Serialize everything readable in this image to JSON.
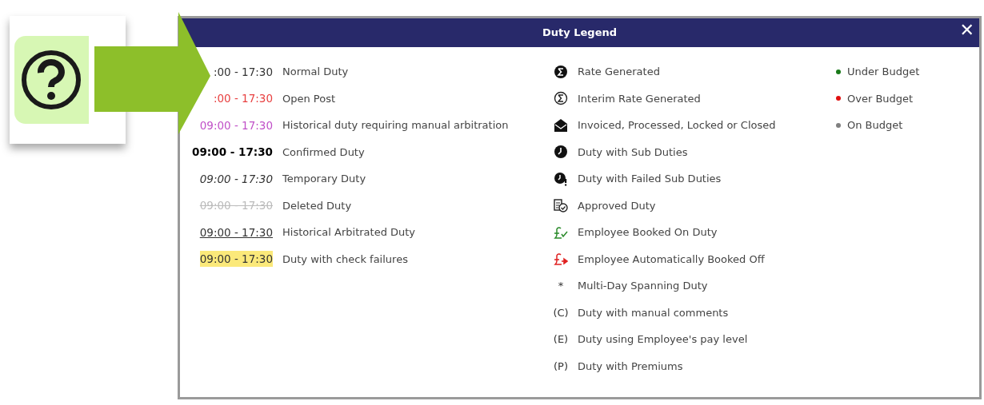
{
  "dialog": {
    "title": "Duty Legend",
    "close": "✕"
  },
  "duty_styles": [
    {
      "kind": "normal",
      "time": ":00 - 17:30",
      "label": "Normal Duty"
    },
    {
      "kind": "open",
      "time": ":00 - 17:30",
      "label": "Open Post"
    },
    {
      "kind": "historical",
      "time": "09:00 - 17:30",
      "label": "Historical duty requiring manual arbitration"
    },
    {
      "kind": "confirmed",
      "time": "09:00 - 17:30",
      "label": "Confirmed Duty"
    },
    {
      "kind": "temporary",
      "time": "09:00 - 17:30",
      "label": "Temporary Duty"
    },
    {
      "kind": "deleted",
      "time": "09:00 - 17:30",
      "label": "Deleted Duty"
    },
    {
      "kind": "arbitrated",
      "time": "09:00 - 17:30",
      "label": "Historical Arbitrated Duty"
    },
    {
      "kind": "check_failure",
      "time": "09:00 - 17:30",
      "label": "Duty with check failures"
    }
  ],
  "icons": [
    {
      "kind": "sigma_filled",
      "label": "Rate Generated"
    },
    {
      "kind": "sigma_outline",
      "label": "Interim Rate Generated"
    },
    {
      "kind": "envelope",
      "label": "Invoiced, Processed, Locked or Closed"
    },
    {
      "kind": "clock",
      "label": "Duty with Sub Duties"
    },
    {
      "kind": "clock_alert",
      "label": "Duty with Failed Sub Duties"
    },
    {
      "kind": "approved",
      "label": "Approved Duty"
    },
    {
      "kind": "booked_on",
      "label": "Employee Booked On Duty"
    },
    {
      "kind": "booked_off",
      "label": "Employee Automatically Booked Off"
    },
    {
      "kind": "text",
      "symbol": "*",
      "label": "Multi-Day Spanning Duty"
    },
    {
      "kind": "text",
      "symbol": "(C)",
      "label": "Duty with manual comments"
    },
    {
      "kind": "text",
      "symbol": "(E)",
      "label": "Duty using Employee's pay level"
    },
    {
      "kind": "text",
      "symbol": "(P)",
      "label": "Duty with Premiums"
    }
  ],
  "budget": [
    {
      "color": "#1a7a1a",
      "label": "Under Budget"
    },
    {
      "color": "#e01010",
      "label": "Over Budget"
    },
    {
      "color": "#808080",
      "label": "On Budget"
    }
  ]
}
